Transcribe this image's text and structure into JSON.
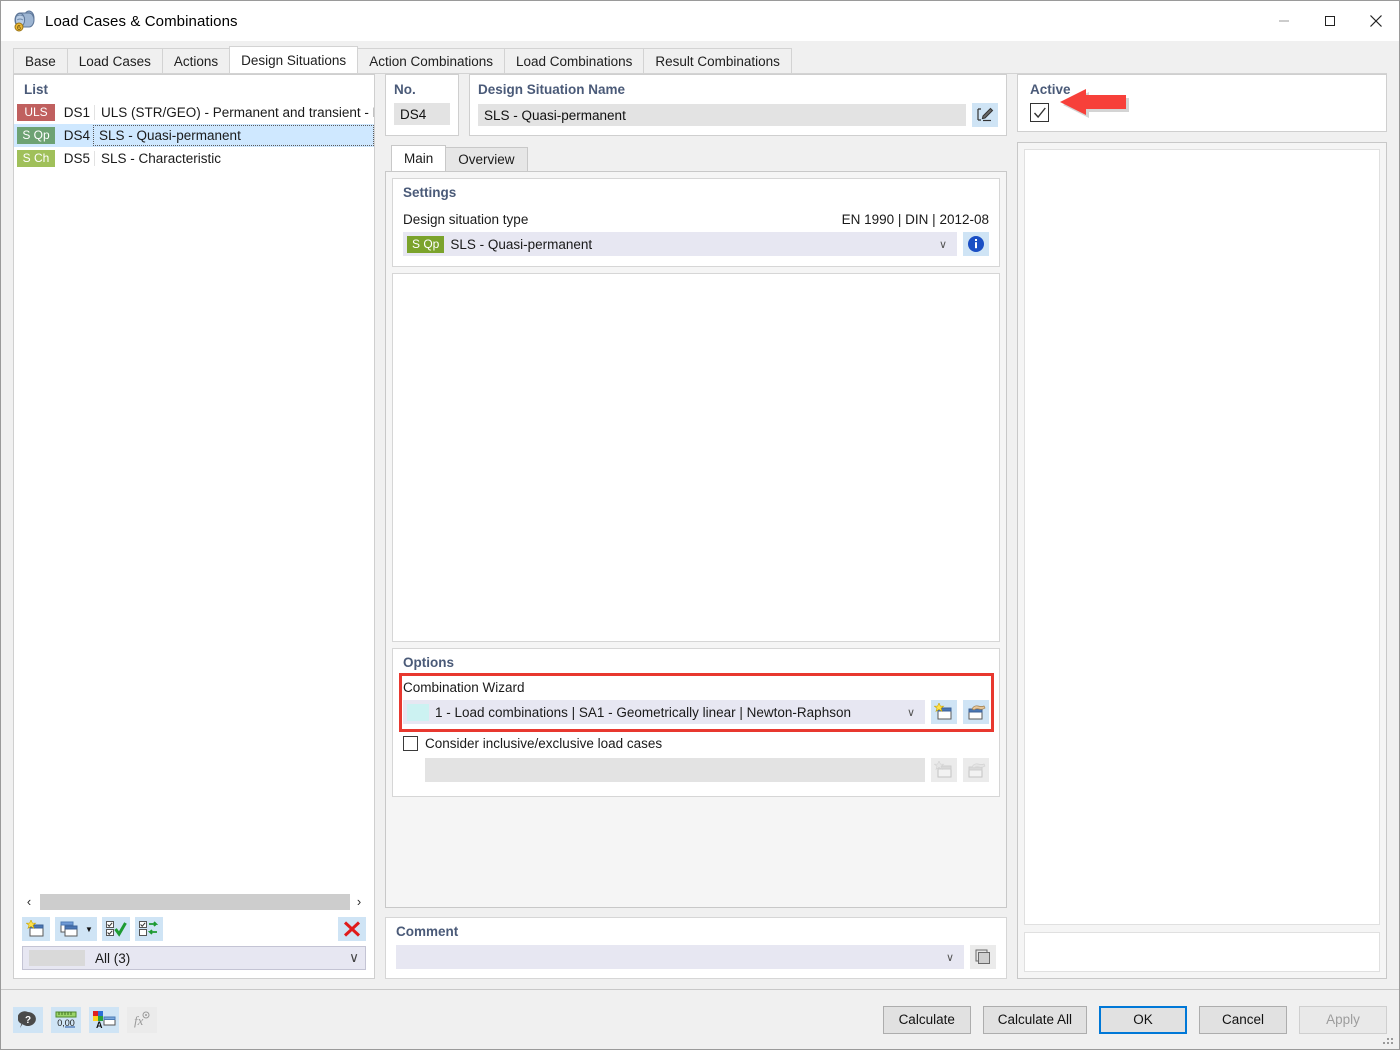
{
  "window": {
    "title": "Load Cases & Combinations",
    "icon": "load-cases-icon",
    "minimize": "minimize-icon",
    "maximize": "maximize-icon",
    "close": "close-icon"
  },
  "tabs": [
    {
      "label": "Base",
      "active": false
    },
    {
      "label": "Load Cases",
      "active": false
    },
    {
      "label": "Actions",
      "active": false
    },
    {
      "label": "Design Situations",
      "active": true
    },
    {
      "label": "Action Combinations",
      "active": false
    },
    {
      "label": "Load Combinations",
      "active": false
    },
    {
      "label": "Result Combinations",
      "active": false
    }
  ],
  "list": {
    "header": "List",
    "rows": [
      {
        "badge": "ULS",
        "badge_color": "#c0605f",
        "no": "DS1",
        "name": "ULS (STR/GEO) - Permanent and transient - Eq. ",
        "selected": false
      },
      {
        "badge": "S Qp",
        "badge_color": "#6da273",
        "no": "DS4",
        "name": "SLS - Quasi-permanent",
        "selected": true
      },
      {
        "badge": "S Ch",
        "badge_color": "#a0c05a",
        "no": "DS5",
        "name": "SLS - Characteristic",
        "selected": false
      }
    ],
    "scroll_left": "‹",
    "scroll_right": "›",
    "toolbar": [
      {
        "name": "new-design-situation-button",
        "icon": "new-window-star-icon"
      },
      {
        "name": "copy-design-situation-button",
        "icon": "copy-window-icon"
      },
      {
        "name": "select-all-button",
        "icon": "check-all-icon"
      },
      {
        "name": "invert-selection-button",
        "icon": "invert-selection-icon"
      },
      {
        "name": "delete-button",
        "icon": "red-x-icon"
      }
    ],
    "filter": {
      "value": "All (3)",
      "caret": "∨"
    }
  },
  "detail": {
    "no_label": "No.",
    "no_value": "DS4",
    "name_label": "Design Situation Name",
    "name_value": "SLS - Quasi-permanent",
    "edit_button_icon": "edit-pencil-icon",
    "tabs": [
      {
        "label": "Main",
        "active": true
      },
      {
        "label": "Overview",
        "active": false
      }
    ],
    "settings": {
      "title": "Settings",
      "type_label": "Design situation type",
      "standard": "EN 1990 | DIN | 2012-08",
      "type_badge": "S Qp",
      "type_badge_color": "#7ba32c",
      "type_value": "SLS - Quasi-permanent",
      "caret": "∨",
      "info_icon": "info-icon"
    },
    "options": {
      "title": "Options",
      "wizard_label": "Combination Wizard",
      "wizard_value": "1 - Load combinations | SA1 - Geometrically linear | Newton-Raphson",
      "wizard_caret": "∨",
      "wizard_new_icon": "new-window-star-icon",
      "wizard_edit_icon": "edit-window-hand-icon",
      "inclusive_label": "Consider inclusive/exclusive load cases",
      "inclusive_checked": false,
      "inclusive_new_icon": "new-window-star-icon",
      "inclusive_edit_icon": "edit-window-hand-icon",
      "highlight_color": "#e8382f"
    },
    "comment": {
      "title": "Comment",
      "value": "",
      "caret": "∨",
      "button_icon": "copy-pages-icon"
    }
  },
  "active": {
    "title": "Active",
    "checked": true,
    "check_glyph": "✓",
    "arrow_color": "#f7403a"
  },
  "footer": {
    "icons": [
      {
        "name": "help-button",
        "icon": "help-bubble-icon",
        "disabled": false
      },
      {
        "name": "units-button",
        "icon": "units-0-00-icon",
        "disabled": false
      },
      {
        "name": "display-properties-button",
        "icon": "colors-font-icon",
        "disabled": false
      },
      {
        "name": "formula-button",
        "icon": "fx-icon",
        "disabled": true
      }
    ],
    "buttons": [
      {
        "label": "Calculate",
        "style": "normal"
      },
      {
        "label": "Calculate All",
        "style": "normal"
      },
      {
        "label": "OK",
        "style": "default"
      },
      {
        "label": "Cancel",
        "style": "normal"
      },
      {
        "label": "Apply",
        "style": "disabled"
      }
    ]
  }
}
